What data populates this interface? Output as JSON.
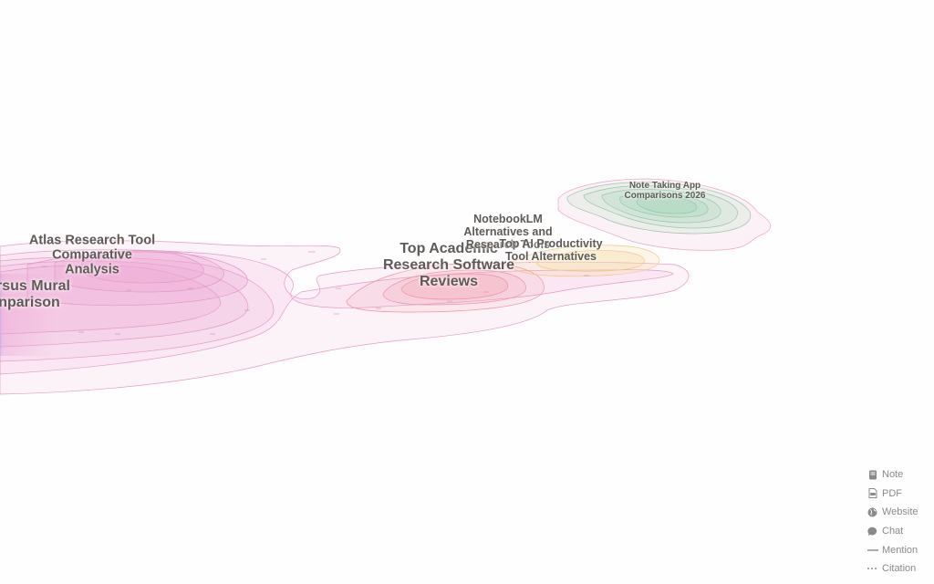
{
  "clusters": [
    {
      "id": "atlas",
      "lines": [
        "Atlas Research Tool",
        "Comparative",
        "Analysis"
      ],
      "color": "#eea6d4"
    },
    {
      "id": "mural",
      "lines": [
        "ersus Mural",
        "nparison"
      ],
      "color": "#c8a6ec"
    },
    {
      "id": "academic",
      "lines": [
        "Top Academic",
        "Research Software",
        "Reviews"
      ],
      "color": "#f3a0b0"
    },
    {
      "id": "notebooklm",
      "lines": [
        "NotebookLM",
        "Alternatives and",
        "Research Tools"
      ],
      "color": "#f2b6c9"
    },
    {
      "id": "productivity",
      "lines": [
        "Top AI Productivity",
        "Tool Alternatives"
      ],
      "color": "#f7d79a"
    },
    {
      "id": "notetaking",
      "lines": [
        "Note Taking App",
        "Comparisons 2026"
      ],
      "color": "#9fd5b4"
    }
  ],
  "legend": {
    "items": [
      {
        "label": "Note",
        "icon": "note-icon"
      },
      {
        "label": "PDF",
        "icon": "pdf-icon"
      },
      {
        "label": "Website",
        "icon": "globe-icon"
      },
      {
        "label": "Chat",
        "icon": "chat-bubble-icon"
      },
      {
        "label": "Mention",
        "icon": "solid-line-icon"
      },
      {
        "label": "Citation",
        "icon": "dotted-line-icon"
      }
    ]
  },
  "colors": {
    "label_text": "#5f5a56",
    "legend_text": "#8a8a8a",
    "contour_pink": "#e7a9cf",
    "contour_green": "#9cc9ad",
    "contour_yellow": "#f2cf8e",
    "contour_red": "#ee9aa8"
  }
}
